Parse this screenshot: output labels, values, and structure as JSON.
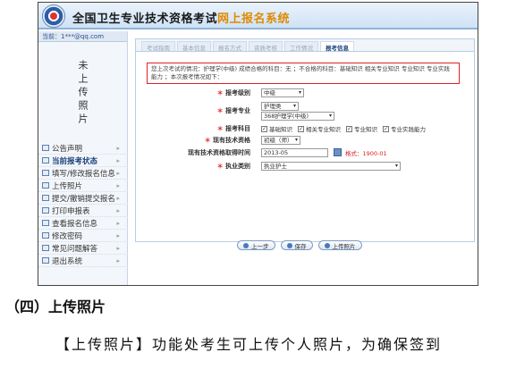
{
  "banner": {
    "title_a": "全国卫生专业技术资格考试",
    "title_b": "网上报名系统"
  },
  "sidebar": {
    "user": "当前：1***@qq.com",
    "photo_placeholder": "未上传照片",
    "menu": [
      {
        "label": "公告声明",
        "active": false
      },
      {
        "label": "当前报考状态",
        "active": true
      },
      {
        "label": "填写/修改报名信息",
        "active": false
      },
      {
        "label": "上传照片",
        "active": false
      },
      {
        "label": "提交/撤销提交报名",
        "active": false
      },
      {
        "label": "打印申报表",
        "active": false
      },
      {
        "label": "查看报名信息",
        "active": false
      },
      {
        "label": "修改密码",
        "active": false
      },
      {
        "label": "常见问题解答",
        "active": false
      },
      {
        "label": "退出系统",
        "active": false
      }
    ]
  },
  "tabs": [
    "考试指南",
    "基本信息",
    "报名方式",
    "资质考核",
    "工作情况",
    "报考信息"
  ],
  "notice": "您上次考试的情况：护理学(中级) 成绩合格的科目：无 ；不合格的科目：基础知识 相关专业知识 专业知识 专业实践能力 ；本次报考情况如下：",
  "form": {
    "level": {
      "label": "报考级别",
      "value": "中级"
    },
    "major": {
      "label": "报考专业",
      "value1": "护理类",
      "value2": "368护理学(中级)"
    },
    "subjects": {
      "label": "报考科目",
      "items": [
        "基础知识",
        "相关专业知识",
        "专业知识",
        "专业实践能力"
      ]
    },
    "tech": {
      "label": "现有技术资格",
      "value": "初级（师）"
    },
    "date": {
      "label": "现有技术资格取得时间",
      "value": "2013-05",
      "format": "格式：1900-01"
    },
    "category": {
      "label": "执业类别",
      "value": "执业护士"
    }
  },
  "buttons": {
    "prev": "上一步",
    "save": "保存",
    "next": "上传照片"
  },
  "doc": {
    "heading": "（四）上传照片",
    "para": "【上传照片】功能处考生可上传个人照片，为确保签到"
  }
}
